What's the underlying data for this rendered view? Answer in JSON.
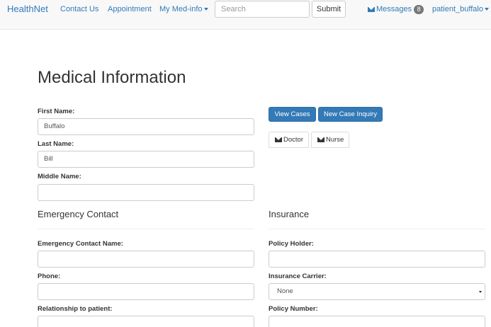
{
  "navbar": {
    "brand": "HealthNet",
    "links": {
      "contact": "Contact Us",
      "appointment": "Appointment",
      "med_info": "My Med-info"
    },
    "search": {
      "placeholder": "Search",
      "value": ""
    },
    "submit_label": "Submit",
    "messages": {
      "label": "Messages",
      "count": "8"
    },
    "user": "patient_buffalo"
  },
  "page": {
    "title": "Medical Information"
  },
  "personal": {
    "first_name": {
      "label": "First Name:",
      "value": "Buffalo"
    },
    "last_name": {
      "label": "Last Name:",
      "value": "Bill"
    },
    "middle_name": {
      "label": "Middle Name:",
      "value": ""
    }
  },
  "actions": {
    "view_cases": "View Cases",
    "new_case": "New Case Inquiry",
    "tabs": [
      "Doctor",
      "Nurse"
    ]
  },
  "emergency": {
    "heading": "Emergency Contact",
    "name": {
      "label": "Emergency Contact Name:",
      "value": ""
    },
    "phone": {
      "label": "Phone:",
      "value": ""
    },
    "relationship": {
      "label": "Relationship to patient:",
      "value": ""
    }
  },
  "insurance": {
    "heading": "Insurance",
    "policy_holder": {
      "label": "Policy Holder:",
      "value": ""
    },
    "carrier": {
      "label": "Insurance Carrier:",
      "selected": "None"
    },
    "policy_number": {
      "label": "Policy Number:",
      "value": ""
    }
  },
  "colors": {
    "primary": "#337ab7",
    "navbar_bg": "#f8f8f8",
    "badge": "#777777",
    "text": "#333333"
  },
  "icons": {
    "messages": "envelope-icon",
    "doctor_tab": "envelope-icon",
    "nurse_tab": "envelope-icon",
    "dropdown": "caret-down-icon"
  }
}
